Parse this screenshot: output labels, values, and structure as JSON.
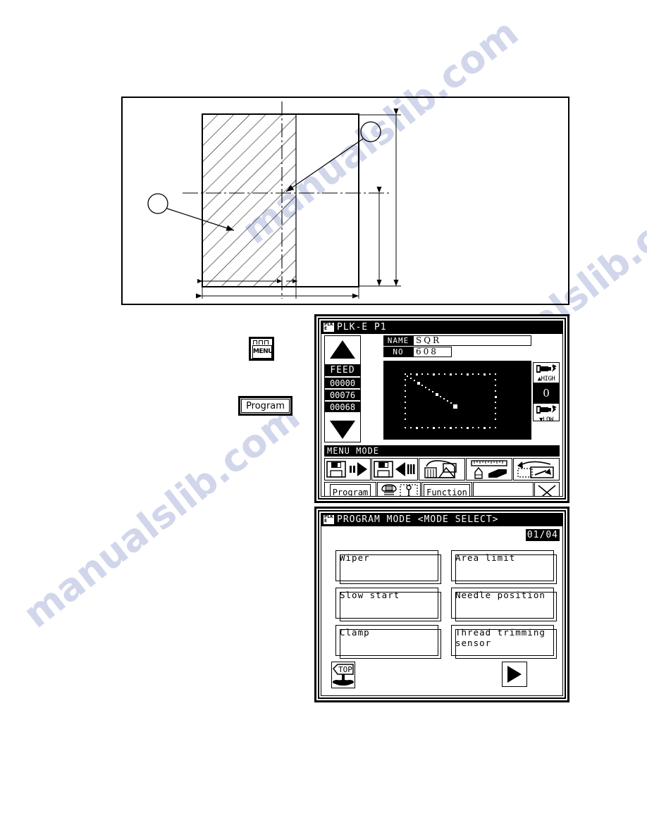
{
  "diagram": {
    "name": "cross-section-dimension-drawing",
    "callout_left": "",
    "callout_right": "",
    "description": "hatched rectangular cross-section with centre lines, vertical and horizontal dimension lines and two blank balloon callouts"
  },
  "hardware_buttons": {
    "menu": {
      "label": "MENU",
      "icon": "menu-folder-icon"
    },
    "program": {
      "label": "Program"
    }
  },
  "panel1": {
    "logo_top": "PLK",
    "logo_bottom": "E",
    "title": "PLK-E P1",
    "scroll_up_icon": "triangle-up-icon",
    "scroll_down_icon": "triangle-down-icon",
    "feed": {
      "label": "FEED",
      "values": [
        "00000",
        "00076",
        "00068"
      ]
    },
    "fields": [
      {
        "key": "NAME",
        "value": "SQR"
      },
      {
        "key": "NO",
        "value": "608"
      }
    ],
    "speed": {
      "high_label": "HIGH",
      "high_icon": "motor-high-icon",
      "value": "0",
      "low_label": "LOW",
      "low_icon": "motor-low-icon"
    },
    "mode_bar": "MENU MODE",
    "tools": [
      {
        "name": "floppy-read-icon",
        "title": ""
      },
      {
        "name": "floppy-write-icon",
        "title": ""
      },
      {
        "name": "pattern-shape-icon",
        "title": ""
      },
      {
        "name": "ruler-pencil-eraser-icon",
        "title": ""
      },
      {
        "name": "transform-move-icon",
        "title": ""
      }
    ],
    "bottom": [
      {
        "type": "text",
        "label": "Program"
      },
      {
        "type": "icons",
        "label": "",
        "icons": [
          "bobbin-icon",
          "needle-position-icon"
        ]
      },
      {
        "type": "text",
        "label": "Function"
      },
      {
        "type": "dither",
        "label": ""
      },
      {
        "type": "close",
        "label": "",
        "icon": "close-x-icon"
      }
    ],
    "pattern": {
      "name": "stitch-pattern-preview",
      "shape": "dotted-rectangle-with-diagonal-line"
    }
  },
  "panel2": {
    "logo_top": "PLK",
    "logo_bottom": "E",
    "title": "PROGRAM MODE <MODE SELECT>",
    "page_indicator": "01/04",
    "menu_items": [
      {
        "label": "Wiper"
      },
      {
        "label": "Area limit"
      },
      {
        "label": "Slow start"
      },
      {
        "label": "Needle position"
      },
      {
        "label": "Clamp"
      },
      {
        "label": "Thread trimming\nsensor"
      }
    ],
    "footer": {
      "top_button_label": "TOP",
      "top_button_icon": "signpost-icon",
      "next_button_icon": "arrow-right-icon"
    }
  },
  "watermarks": [
    "manualslib.com",
    "manualslib.com",
    "manualslib.com"
  ]
}
